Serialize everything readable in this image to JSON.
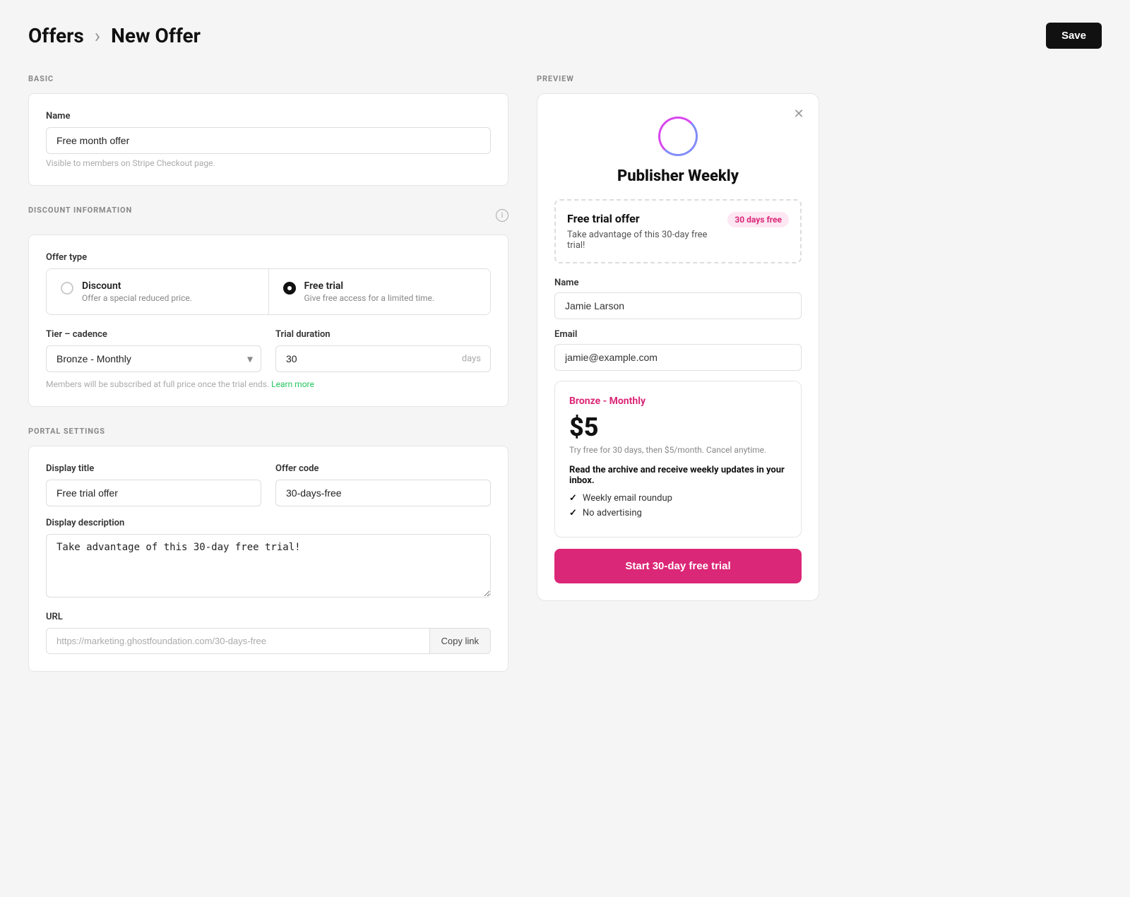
{
  "header": {
    "breadcrumb_root": "Offers",
    "separator": "›",
    "breadcrumb_current": "New Offer",
    "save_button": "Save"
  },
  "basic_section": {
    "label": "BASIC",
    "name_field": {
      "label": "Name",
      "value": "Free month offer",
      "helper": "Visible to members on Stripe Checkout page."
    }
  },
  "discount_section": {
    "label": "DISCOUNT INFORMATION",
    "offer_type_label": "Offer type",
    "options": [
      {
        "id": "discount",
        "title": "Discount",
        "desc": "Offer a special reduced price.",
        "checked": false
      },
      {
        "id": "free-trial",
        "title": "Free trial",
        "desc": "Give free access for a limited time.",
        "checked": true
      }
    ],
    "tier_cadence_label": "Tier – cadence",
    "tier_cadence_value": "Bronze - Monthly",
    "trial_duration_label": "Trial duration",
    "trial_duration_value": "30",
    "trial_duration_unit": "days",
    "subscription_note": "Members will be subscribed at full price once the trial ends.",
    "learn_more": "Learn more"
  },
  "portal_section": {
    "label": "PORTAL SETTINGS",
    "display_title_label": "Display title",
    "display_title_value": "Free trial offer",
    "offer_code_label": "Offer code",
    "offer_code_value": "30-days-free",
    "display_description_label": "Display description",
    "display_description_value": "Take advantage of this 30-day free trial!",
    "url_label": "URL",
    "url_value": "https://marketing.ghostfoundation.com/30-days-free",
    "copy_button": "Copy link"
  },
  "preview": {
    "label": "PREVIEW",
    "publisher_name": "Publisher Weekly",
    "offer_banner": {
      "title": "Free trial offer",
      "description": "Take advantage of this 30-day free trial!",
      "badge": "30 days free"
    },
    "name_label": "Name",
    "name_value": "Jamie Larson",
    "email_label": "Email",
    "email_value": "jamie@example.com",
    "tier": {
      "name": "Bronze - Monthly",
      "price": "$5",
      "trial_note": "Try free for 30 days, then $5/month. Cancel anytime.",
      "features_title": "Read the archive and receive weekly updates in your inbox.",
      "features": [
        "Weekly email roundup",
        "No advertising"
      ]
    },
    "cta_button": "Start 30-day free trial"
  }
}
